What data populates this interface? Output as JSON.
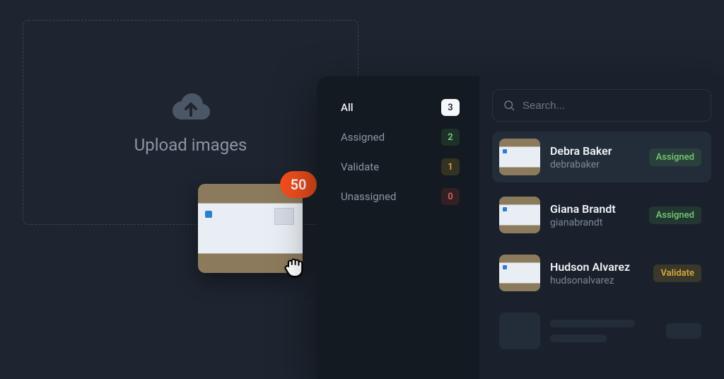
{
  "dropzone": {
    "label": "Upload images"
  },
  "drag": {
    "count": "50"
  },
  "filters": [
    {
      "label": "All",
      "count": "3",
      "count_style": "count-white",
      "active": true
    },
    {
      "label": "Assigned",
      "count": "2",
      "count_style": "count-green",
      "active": false
    },
    {
      "label": "Validate",
      "count": "1",
      "count_style": "count-yellow",
      "active": false
    },
    {
      "label": "Unassigned",
      "count": "0",
      "count_style": "count-red",
      "active": false
    }
  ],
  "search": {
    "placeholder": "Search..."
  },
  "items": [
    {
      "name": "Debra Baker",
      "handle": "debrabaker",
      "status": "Assigned",
      "status_style": "status-assigned",
      "selected": true
    },
    {
      "name": "Giana Brandt",
      "handle": "gianabrandt",
      "status": "Assigned",
      "status_style": "status-assigned",
      "selected": false
    },
    {
      "name": "Hudson Alvarez",
      "handle": "hudsonalvarez",
      "status": "Validate",
      "status_style": "status-validate",
      "selected": false
    }
  ]
}
